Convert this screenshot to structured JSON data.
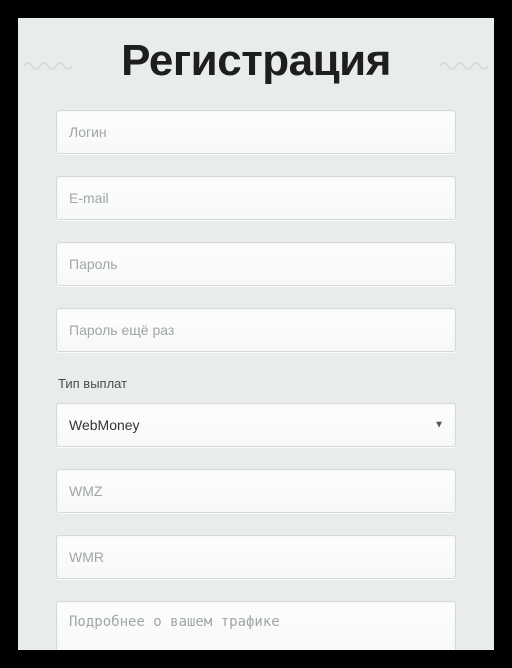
{
  "header": {
    "title": "Регистрация"
  },
  "form": {
    "login_placeholder": "Логин",
    "email_placeholder": "E-mail",
    "password_placeholder": "Пароль",
    "password_confirm_placeholder": "Пароль ещё раз",
    "payment_type_label": "Тип выплат",
    "payment_type_selected": "WebMoney",
    "wmz_placeholder": "WMZ",
    "wmr_placeholder": "WMR",
    "traffic_placeholder": "Подробнее о вашем трафике"
  }
}
